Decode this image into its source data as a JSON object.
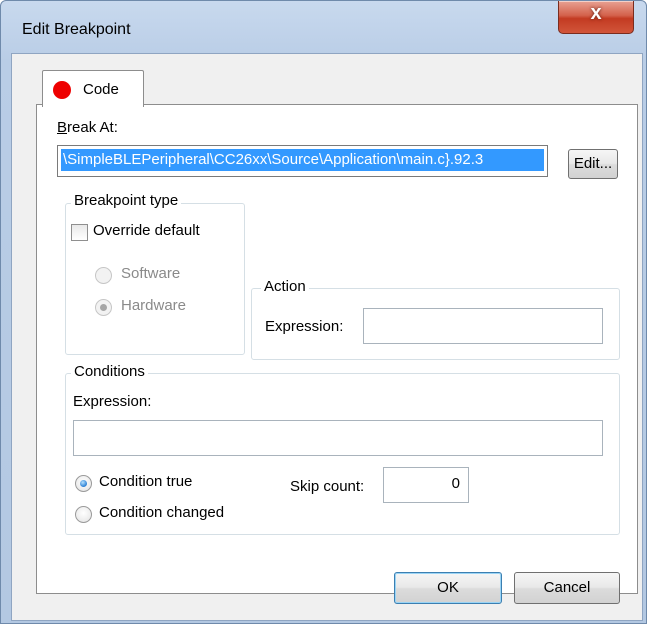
{
  "window": {
    "title": "Edit Breakpoint",
    "close_glyph": "x"
  },
  "tabs": [
    {
      "label": "Code",
      "icon": "red-dot-icon",
      "color": "#ee0000"
    }
  ],
  "break_at": {
    "label": "Break At:",
    "value": "\\SimpleBLEPeripheral\\CC26xx\\Source\\Application\\main.c}.92.3",
    "edit_button": "Edit..."
  },
  "breakpoint_type": {
    "title": "Breakpoint type",
    "override_default": {
      "label": "Override default",
      "checked": false
    },
    "options": [
      {
        "label": "Software",
        "selected": false,
        "enabled": false
      },
      {
        "label": "Hardware",
        "selected": true,
        "enabled": false
      }
    ]
  },
  "action": {
    "title": "Action",
    "expression_label": "Expression:",
    "expression_value": ""
  },
  "conditions": {
    "title": "Conditions",
    "expression_label": "Expression:",
    "expression_value": "",
    "options": [
      {
        "label": "Condition true",
        "selected": true
      },
      {
        "label": "Condition changed",
        "selected": false
      }
    ],
    "skip_count_label": "Skip count:",
    "skip_count_value": "0"
  },
  "buttons": {
    "ok": "OK",
    "cancel": "Cancel"
  },
  "colors": {
    "selection": "#3399ff",
    "close_button": "#c33b22",
    "accent_border": "#3c7fb1"
  }
}
